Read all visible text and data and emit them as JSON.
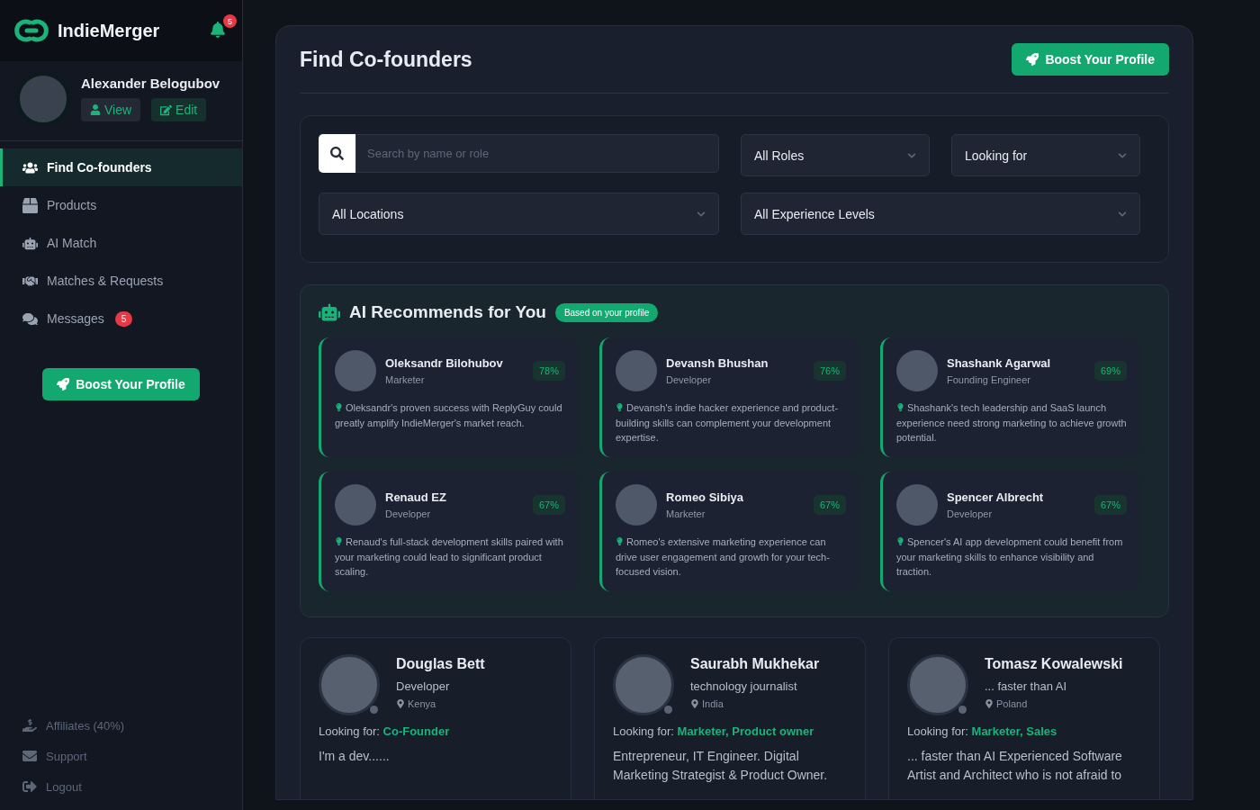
{
  "brand": {
    "name": "IndieMerger",
    "notifications": "5"
  },
  "user": {
    "name": "Alexander Belogubov",
    "view": "View",
    "edit": "Edit"
  },
  "nav": [
    {
      "label": "Find Co-founders",
      "selected": true
    },
    {
      "label": "Products",
      "selected": false
    },
    {
      "label": "AI Match",
      "selected": false
    },
    {
      "label": "Matches & Requests",
      "selected": false
    },
    {
      "label": "Messages",
      "selected": false,
      "badge": "5"
    }
  ],
  "sidebar_boost": "Boost Your Profile",
  "footer_nav": [
    {
      "label": "Affiliates (40%)"
    },
    {
      "label": "Support"
    },
    {
      "label": "Logout"
    }
  ],
  "page": {
    "title": "Find Co-founders",
    "boost": "Boost Your Profile"
  },
  "filters": {
    "search": {
      "placeholder": "Search by name or role"
    },
    "roles": "All Roles",
    "looking": "Looking for",
    "locations": "All Locations",
    "experience": "All Experience Levels"
  },
  "ai": {
    "title": "AI Recommends for You",
    "badge": "Based on your profile",
    "cards": [
      {
        "name": "Oleksandr Bilohubov",
        "role": "Marketer",
        "match": "78%",
        "reason": "Oleksandr's proven success with ReplyGuy could greatly amplify IndieMerger's market reach."
      },
      {
        "name": "Devansh Bhushan",
        "role": "Developer",
        "match": "76%",
        "reason": "Devansh's indie hacker experience and product-building skills can complement your development expertise."
      },
      {
        "name": "Shashank Agarwal",
        "role": "Founding Engineer",
        "match": "69%",
        "reason": "Shashank's tech leadership and SaaS launch experience need strong marketing to achieve growth potential."
      },
      {
        "name": "Renaud EZ",
        "role": "Developer",
        "match": "67%",
        "reason": "Renaud's full-stack development skills paired with your marketing could lead to significant product scaling."
      },
      {
        "name": "Romeo Sibiya",
        "role": "Marketer",
        "match": "67%",
        "reason": "Romeo's extensive marketing experience can drive user engagement and growth for your tech-focused vision."
      },
      {
        "name": "Spencer Albrecht",
        "role": "Developer",
        "match": "67%",
        "reason": "Spencer's AI app development could benefit from your marketing skills to enhance visibility and traction."
      }
    ]
  },
  "profiles": [
    {
      "name": "Douglas Bett",
      "role": "Developer",
      "location": "Kenya",
      "online": false,
      "looking_label": "Looking for:",
      "looking": "Co-Founder",
      "bio": "I'm a dev......"
    },
    {
      "name": "Saurabh Mukhekar",
      "role": "technology journalist",
      "location": "India",
      "online": false,
      "looking_label": "Looking for:",
      "looking": "Marketer, Product owner",
      "bio": "Entrepreneur, IT Engineer. Digital Marketing Strategist & Product Owner."
    },
    {
      "name": "Tomasz Kowalewski",
      "role": "... faster than AI",
      "location": "Poland",
      "online": false,
      "looking_label": "Looking for:",
      "looking": "Marketer, Sales",
      "bio": "... faster than AI Experienced Software Artist and Architect who is not afraid to"
    }
  ]
}
